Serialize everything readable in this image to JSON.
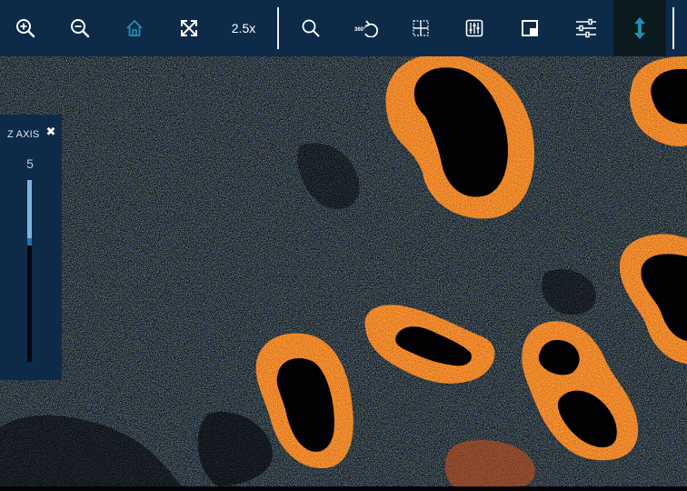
{
  "toolbar": {
    "zoom_level": "2.5x",
    "buttons": [
      {
        "name": "zoom-in",
        "icon": "zoom-in-icon"
      },
      {
        "name": "zoom-out",
        "icon": "zoom-out-icon"
      },
      {
        "name": "home",
        "icon": "home-icon",
        "active": true
      },
      {
        "name": "full-screen",
        "icon": "expand-arrows-icon"
      },
      {
        "name": "search",
        "icon": "magnifier-icon"
      },
      {
        "name": "rotate-360",
        "icon": "rotate-360-icon"
      },
      {
        "name": "grid",
        "icon": "grid-icon"
      },
      {
        "name": "adjust-channels",
        "icon": "sliders-vertical-icon"
      },
      {
        "name": "minimap",
        "icon": "minimap-icon"
      },
      {
        "name": "settings",
        "icon": "sliders-horizontal-icon"
      },
      {
        "name": "z-axis",
        "icon": "vertical-arrows-icon",
        "active": true
      }
    ],
    "colors": {
      "bar": "#0d2a49",
      "icon": "#ffffff",
      "active_icon": "#1f8fb7"
    }
  },
  "z_axis_panel": {
    "title": "Z AXIS",
    "close_icon": "close-icon",
    "value": "5",
    "slider_level": 0.34
  },
  "image": {
    "description_colors": {
      "nuclei": "#2b3bd0",
      "green_signal": "#36b23a",
      "orange_signal": "#f07a14"
    }
  }
}
